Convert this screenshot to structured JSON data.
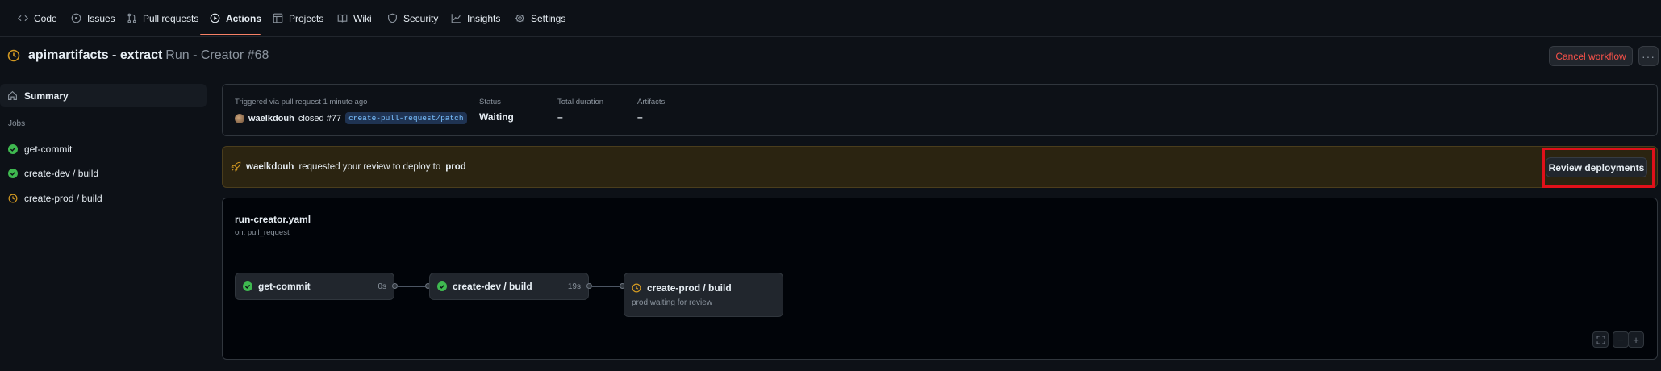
{
  "nav": {
    "tabs": [
      {
        "label": "Code",
        "icon": "code-icon"
      },
      {
        "label": "Issues",
        "icon": "issue-opened-icon"
      },
      {
        "label": "Pull requests",
        "icon": "git-pull-request-icon"
      },
      {
        "label": "Actions",
        "icon": "play-icon",
        "active": true
      },
      {
        "label": "Projects",
        "icon": "table-icon"
      },
      {
        "label": "Wiki",
        "icon": "book-icon"
      },
      {
        "label": "Security",
        "icon": "shield-icon"
      },
      {
        "label": "Insights",
        "icon": "graph-icon"
      },
      {
        "label": "Settings",
        "icon": "gear-icon"
      }
    ]
  },
  "header": {
    "workflow_name": "apimartifacts - extract",
    "run_label": "Run - Creator #68",
    "cancel_label": "Cancel workflow",
    "more_label": "···",
    "status_icon": "clock-icon"
  },
  "sidebar": {
    "summary_label": "Summary",
    "jobs_heading": "Jobs",
    "jobs": [
      {
        "label": "get-commit",
        "status": "success"
      },
      {
        "label": "create-dev / build",
        "status": "success"
      },
      {
        "label": "create-prod / build",
        "status": "waiting"
      }
    ]
  },
  "summary": {
    "trigger_text": "Triggered via pull request 1 minute ago",
    "actor": "waelkdouh",
    "action_text": "closed #77",
    "branch": "create-pull-request/patch",
    "status_label": "Status",
    "status_value": "Waiting",
    "duration_label": "Total duration",
    "duration_value": "–",
    "artifacts_label": "Artifacts",
    "artifacts_value": "–"
  },
  "review": {
    "actor": "waelkdouh",
    "message": "requested your review to deploy to",
    "environment": "prod",
    "button_label": "Review deployments"
  },
  "graph": {
    "file": "run-creator.yaml",
    "trigger": "on: pull_request",
    "nodes": [
      {
        "label": "get-commit",
        "time": "0s",
        "status": "success"
      },
      {
        "label": "create-dev / build",
        "time": "19s",
        "status": "success"
      },
      {
        "label": "create-prod / build",
        "subtitle": "prod waiting for review",
        "status": "waiting"
      }
    ],
    "zoom": {
      "fullscreen_icon": "fullscreen-icon",
      "minus_label": "−",
      "plus_label": "+"
    }
  },
  "colors": {
    "accent_tab": "#f78166",
    "success": "#3fb950",
    "waiting": "#d29922",
    "danger": "#f85149",
    "highlight": "#e0101a"
  }
}
